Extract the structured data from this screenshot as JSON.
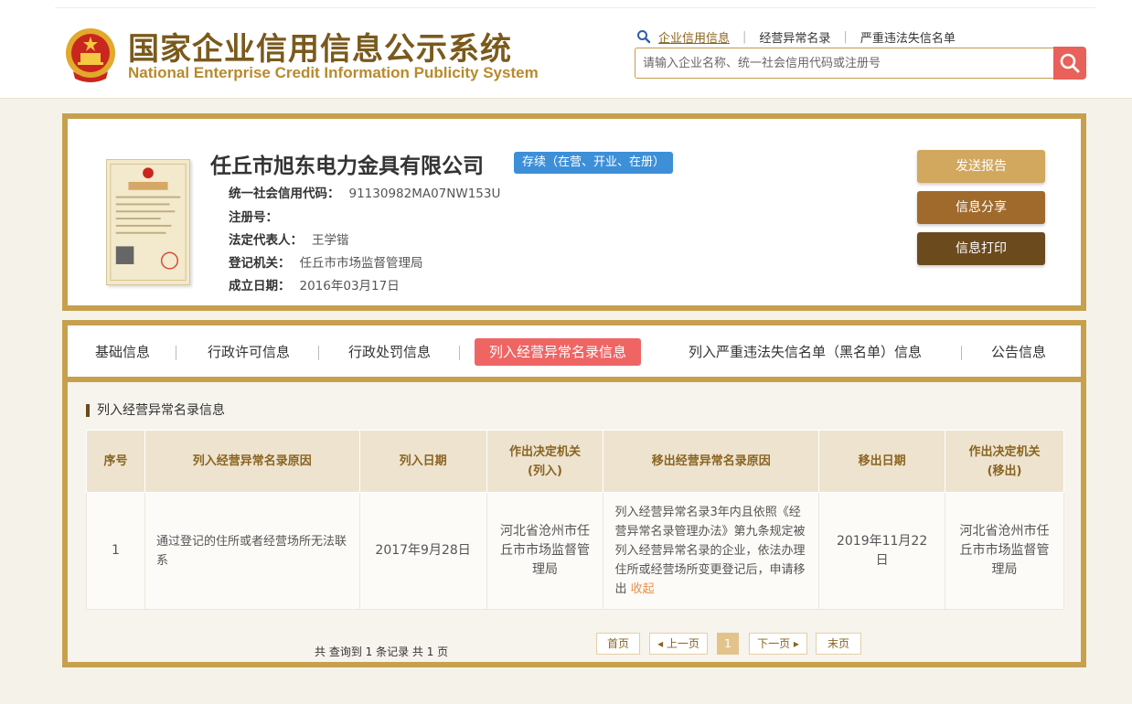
{
  "header": {
    "title_cn": "国家企业信用信息公示系统",
    "title_en": "National Enterprise Credit Information Publicity System",
    "links": [
      "企业信用信息",
      "经营异常名录",
      "严重违法失信名单"
    ],
    "search_placeholder": "请输入企业名称、统一社会信用代码或注册号"
  },
  "company": {
    "name": "任丘市旭东电力金具有限公司",
    "status": "存续（在营、开业、在册）",
    "fields": [
      {
        "label": "统一社会信用代码：",
        "value": "91130982MA07NW153U"
      },
      {
        "label": "注册号：",
        "value": ""
      },
      {
        "label": "法定代表人：",
        "value": "王学锴"
      },
      {
        "label": "登记机关：",
        "value": "任丘市市场监督管理局"
      },
      {
        "label": "成立日期：",
        "value": "2016年03月17日"
      }
    ],
    "buttons": {
      "report": "发送报告",
      "share": "信息分享",
      "print": "信息打印"
    }
  },
  "tabs": [
    "基础信息",
    "行政许可信息",
    "行政处罚信息",
    "列入经营异常名录信息",
    "列入严重违法失信名单（黑名单）信息",
    "公告信息"
  ],
  "section_title": "列入经营异常名录信息",
  "table": {
    "headers": [
      "序号",
      "列入经营异常名录原因",
      "列入日期",
      "作出决定机关(列入)",
      "移出经营异常名录原因",
      "移出日期",
      "作出决定机关(移出)"
    ],
    "rows": [
      {
        "index": "1",
        "reason_in": "通过登记的住所或者经营场所无法联系",
        "date_in": "2017年9月28日",
        "authority_in": "河北省沧州市任丘市市场监督管理局",
        "reason_out": "列入经营异常名录3年内且依照《经营异常名录管理办法》第九条规定被列入经营异常名录的企业，依法办理住所或经营场所变更登记后，申请移出",
        "collapse": "收起",
        "date_out": "2019年11月22日",
        "authority_out": "河北省沧州市任丘市市场监督管理局"
      }
    ]
  },
  "pagination": {
    "total": "共 查询到 1 条记录 共 1 页",
    "first": "首页",
    "prev": "上一页",
    "current": "1",
    "next": "下一页",
    "last": "末页"
  },
  "colors": {
    "gold_border": "#c7a04e",
    "active_tab": "#ef6564",
    "badge": "#3d8fd8",
    "search_btn": "#e8615a"
  }
}
